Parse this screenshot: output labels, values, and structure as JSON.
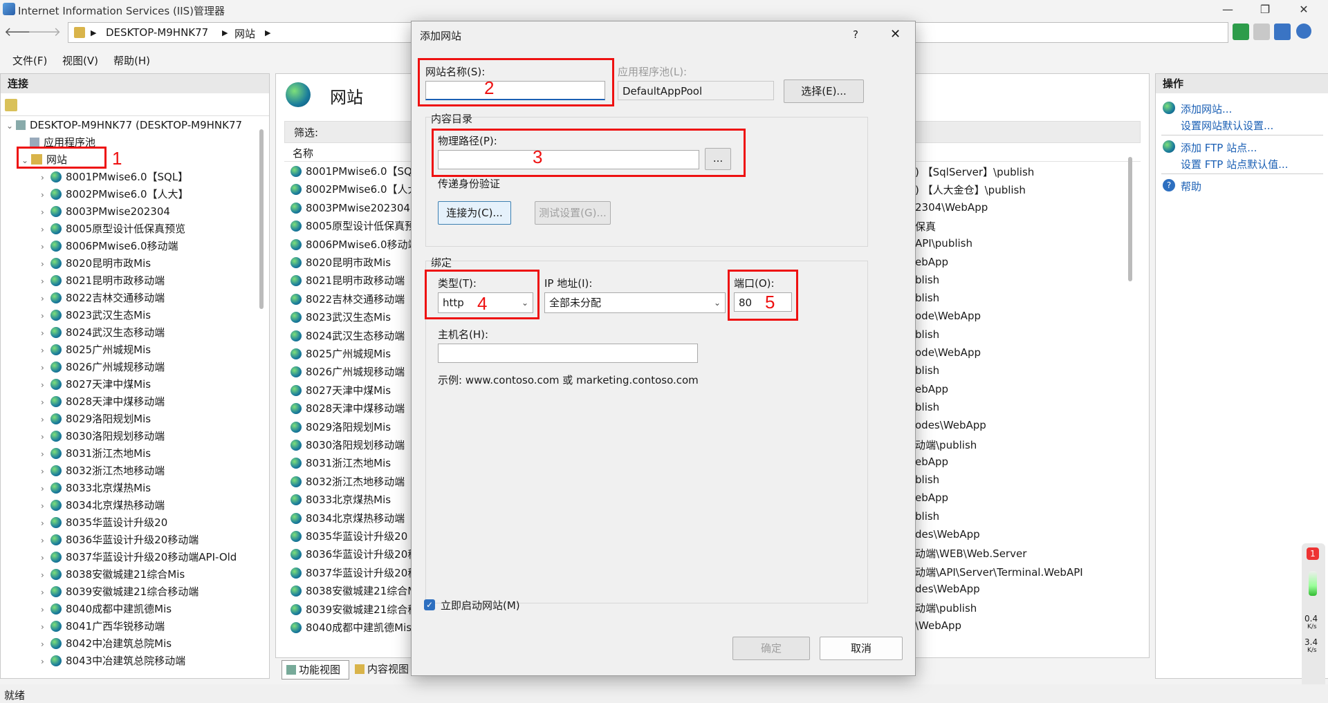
{
  "window": {
    "title": "Internet Information Services (IIS)管理器"
  },
  "address": {
    "crumbs": [
      "DESKTOP-M9HNK77",
      "网站"
    ]
  },
  "menu": {
    "file": "文件(F)",
    "view": "视图(V)",
    "help": "帮助(H)"
  },
  "connections": {
    "header": "连接",
    "server": "DESKTOP-M9HNK77 (DESKTOP-M9HNK77",
    "app_pools": "应用程序池",
    "sites_node": "网站",
    "sites": [
      "8001PMwise6.0【SQL】",
      "8002PMwise6.0【人大】",
      "8003PMwise202304",
      "8005原型设计低保真预览",
      "8006PMwise6.0移动端",
      "8020昆明市政Mis",
      "8021昆明市政移动端",
      "8022吉林交通移动端",
      "8023武汉生态Mis",
      "8024武汉生态移动端",
      "8025广州城规Mis",
      "8026广州城规移动端",
      "8027天津中煤Mis",
      "8028天津中煤移动端",
      "8029洛阳规划Mis",
      "8030洛阳规划移动端",
      "8031浙江杰地Mis",
      "8032浙江杰地移动端",
      "8033北京煤热Mis",
      "8034北京煤热移动端",
      "8035华蓝设计升级20",
      "8036华蓝设计升级20移动端",
      "8037华蓝设计升级20移动端API-Old",
      "8038安徽城建21综合Mis",
      "8039安徽城建21综合移动端",
      "8040成都中建凯德Mis",
      "8041广西华锐移动端",
      "8042中冶建筑总院Mis",
      "8043中冶建筑总院移动端"
    ]
  },
  "middle": {
    "title": "网站",
    "filter_label": "筛选:",
    "col_name": "名称",
    "rows": [
      "8001PMwise6.0【SQL",
      "8002PMwise6.0【人大",
      "8003PMwise202304",
      "8005原型设计低保真预",
      "8006PMwise6.0移动端",
      "8020昆明市政Mis",
      "8021昆明市政移动端",
      "8022吉林交通移动端",
      "8023武汉生态Mis",
      "8024武汉生态移动端",
      "8025广州城规Mis",
      "8026广州城规移动端",
      "8027天津中煤Mis",
      "8028天津中煤移动端",
      "8029洛阳规划Mis",
      "8030洛阳规划移动端",
      "8031浙江杰地Mis",
      "8032浙江杰地移动端",
      "8033北京煤热Mis",
      "8034北京煤热移动端",
      "8035华蓝设计升级20",
      "8036华蓝设计升级20移",
      "8037华蓝设计升级20移",
      "8038安徽城建21综合M",
      "8039安徽城建21综合移",
      "8040成都中建凯德Mis"
    ],
    "paths": [
      ") 【SqlServer】\\publish",
      ") 【人大金仓】\\publish",
      "2304\\WebApp",
      "保真",
      "API\\publish",
      "ebApp",
      "blish",
      "blish",
      "ode\\WebApp",
      "blish",
      "ode\\WebApp",
      "blish",
      "ebApp",
      "blish",
      "odes\\WebApp",
      "动端\\publish",
      "ebApp",
      "blish",
      "ebApp",
      "blish",
      "des\\WebApp",
      "动端\\WEB\\Web.Server",
      "动端\\API\\Server\\Terminal.WebAPI",
      "des\\WebApp",
      "动端\\publish",
      "\\WebApp"
    ],
    "tab_features": "功能视图",
    "tab_content": "内容视图"
  },
  "actions": {
    "header": "操作",
    "add_site": "添加网站...",
    "site_defaults": "设置网站默认设置...",
    "add_ftp": "添加 FTP 站点...",
    "ftp_defaults": "设置 FTP 站点默认值...",
    "help": "帮助"
  },
  "status": {
    "text": "就绪"
  },
  "dialog": {
    "title": "添加网站",
    "question": "?",
    "site_name_label": "网站名称(S):",
    "site_name_value": "",
    "app_pool_label": "应用程序池(L):",
    "app_pool_value": "DefaultAppPool",
    "select_button": "选择(E)...",
    "content_dir": "内容目录",
    "physical_path_label": "物理路径(P):",
    "physical_path_value": "",
    "browse_button": "...",
    "passthrough_auth": "传递身份验证",
    "connect_as": "连接为(C)...",
    "test_settings": "测试设置(G)...",
    "binding": "绑定",
    "type_label": "类型(T):",
    "type_value": "http",
    "ip_label": "IP 地址(I):",
    "ip_value": "全部未分配",
    "port_label": "端口(O):",
    "port_value": "80",
    "host_label": "主机名(H):",
    "host_value": "",
    "example": "示例: www.contoso.com 或 marketing.contoso.com",
    "start_now": "立即启动网站(M)",
    "ok": "确定",
    "cancel": "取消"
  },
  "annotations": {
    "n1": "1",
    "n2": "2",
    "n3": "3",
    "n4": "4",
    "n5": "5"
  },
  "speed": {
    "up": "0.4",
    "up_unit": "K/s",
    "down": "3.4",
    "down_unit": "K/s"
  }
}
